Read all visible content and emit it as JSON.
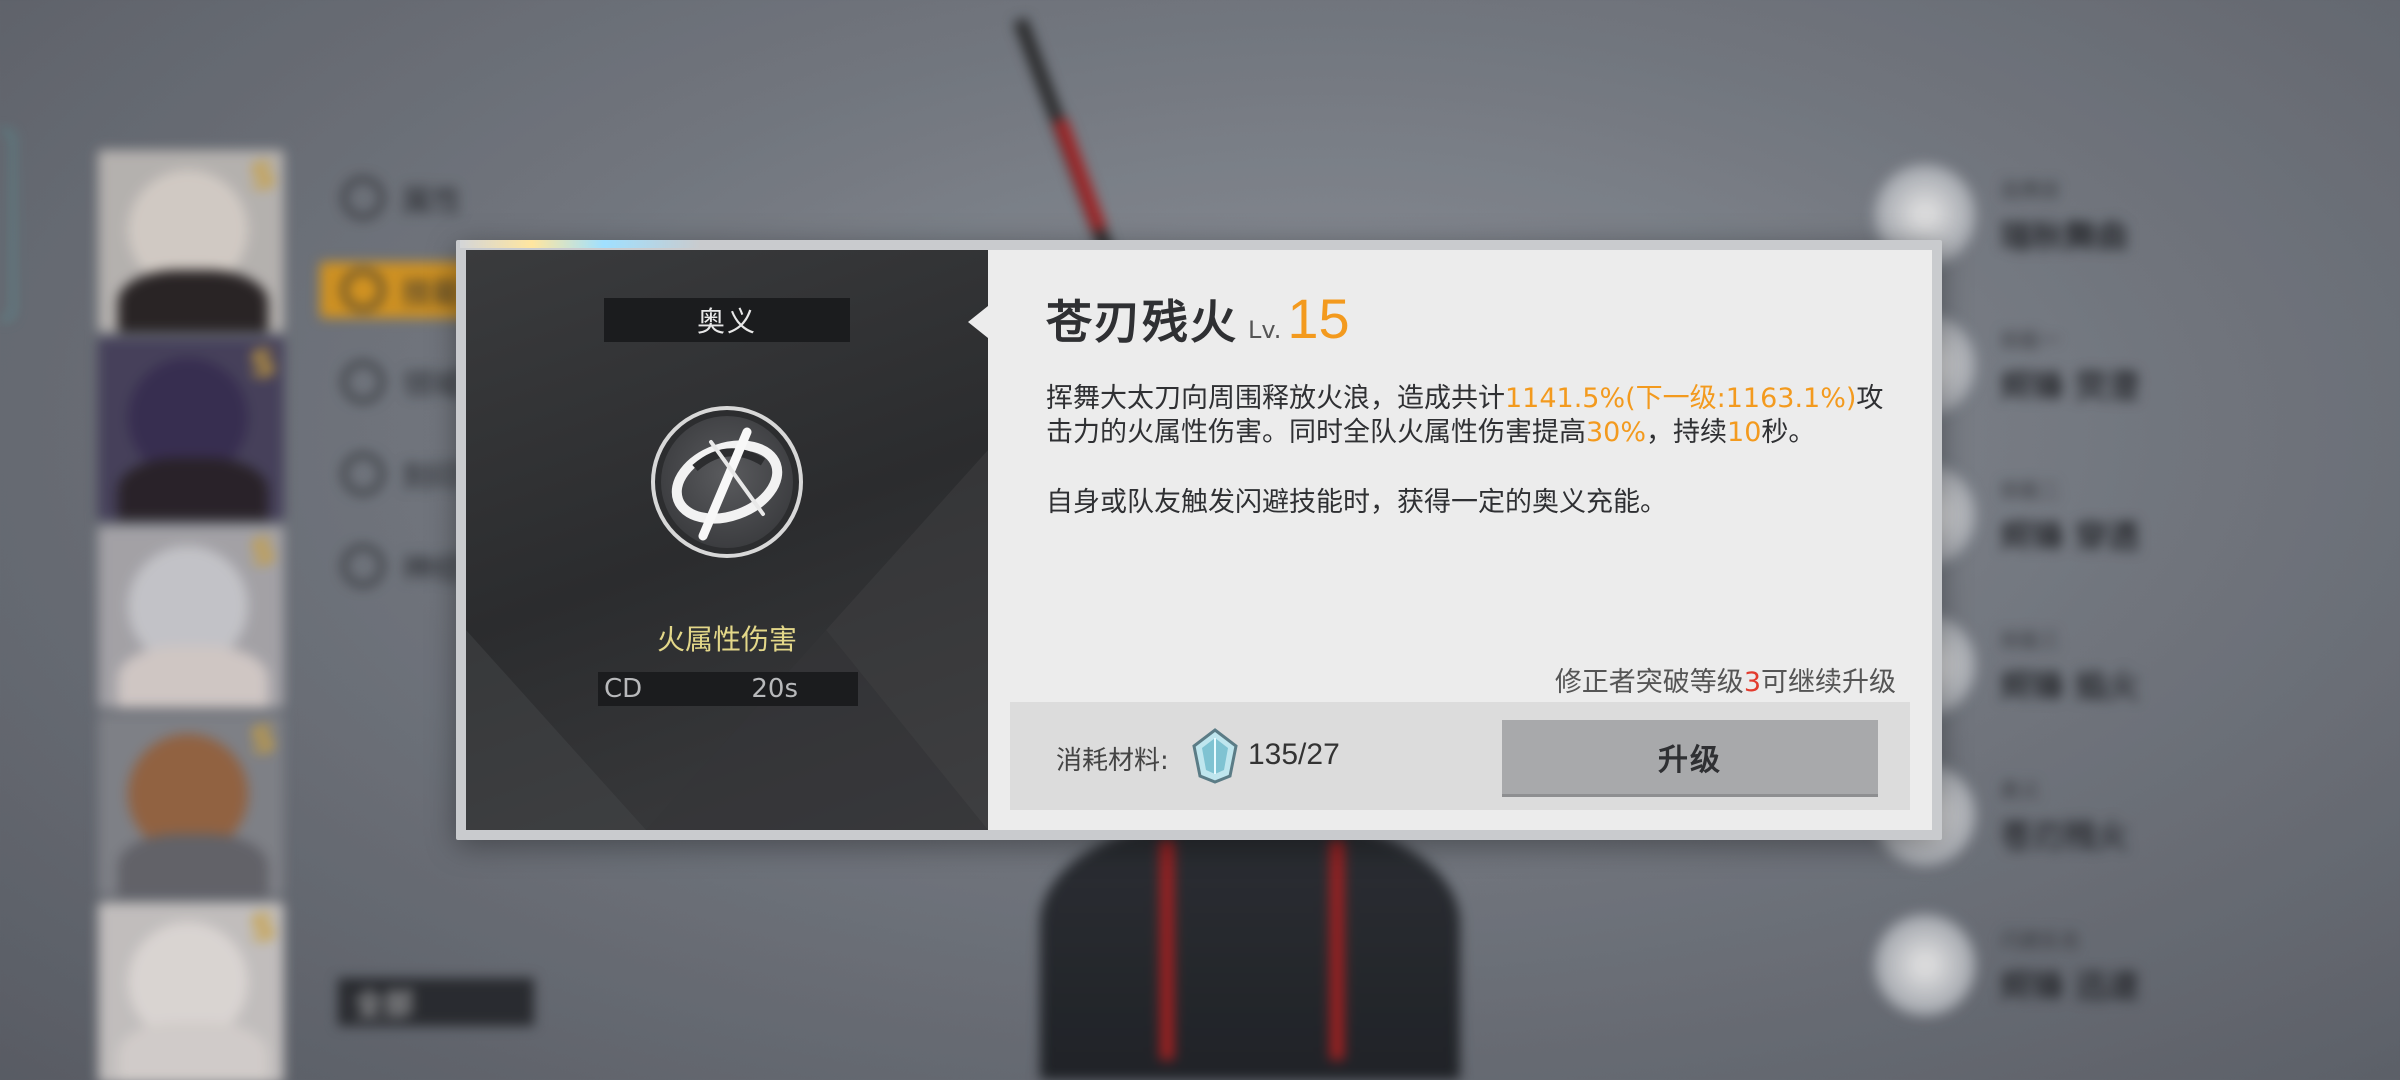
{
  "background": {
    "menu": [
      {
        "label": "属性",
        "active": false
      },
      {
        "label": "技能",
        "active": true
      },
      {
        "label": "领域",
        "active": false
      },
      {
        "label": "刻印",
        "active": false
      },
      {
        "label": "神经",
        "active": false
      }
    ],
    "all_filter_label": "全部",
    "roster": [
      {
        "rank": "S",
        "hair": "#e8e0d8",
        "body": "#2a2424"
      },
      {
        "rank": "S",
        "hair": "#3a2f55",
        "body": "#2a2228"
      },
      {
        "rank": "S",
        "hair": "#d8d8dc",
        "body": "#e6dcd8"
      },
      {
        "rank": "S",
        "hair": "#a06a44",
        "body": "#6a6a70"
      },
      {
        "rank": "S",
        "hair": "#f2ece8",
        "body": "#e8e2de"
      }
    ],
    "skills": [
      {
        "sub": "连携技",
        "name": "瑞秋舞曲"
      },
      {
        "sub": "技能一",
        "name": "烬锋 荧澄"
      },
      {
        "sub": "技能二",
        "name": "烬锋 穿透"
      },
      {
        "sub": "技能三",
        "name": "烬锋 焰火"
      },
      {
        "sub": "奥义",
        "name": "苍刃残火"
      },
      {
        "sub": "闪避反击",
        "name": "烬锋 迅速"
      }
    ]
  },
  "modal": {
    "category_tag": "奥义",
    "damage_type": "火属性伤害",
    "cd_label": "CD",
    "cd_value": "20s",
    "skill_name": "苍刃残火",
    "level_label": "Lv.",
    "level_value": "15",
    "description": {
      "part1": "挥舞大太刀向周围释放火浪，造成共计",
      "dmg": "1141.5%(下一级:1163.1%)",
      "part2": "攻击力的火属性伤害。同时全队火属性伤害提高",
      "buff": "30%",
      "part3": "，持续",
      "duration": "10",
      "part4": "秒。"
    },
    "description_2": "自身或队友触发闪避技能时，获得一定的奥义充能。",
    "upgrade_note": {
      "prefix": "修正者突破等级",
      "level": "3",
      "suffix": "可继续升级"
    },
    "cost_label": "消耗材料:",
    "material_icon": "crystal-material-icon",
    "material_count": "135/27",
    "upgrade_button": "升级"
  },
  "colors": {
    "accent_orange": "#f39a1e",
    "damage_type_yellow": "#e3d789",
    "red": "#e23b2e"
  }
}
